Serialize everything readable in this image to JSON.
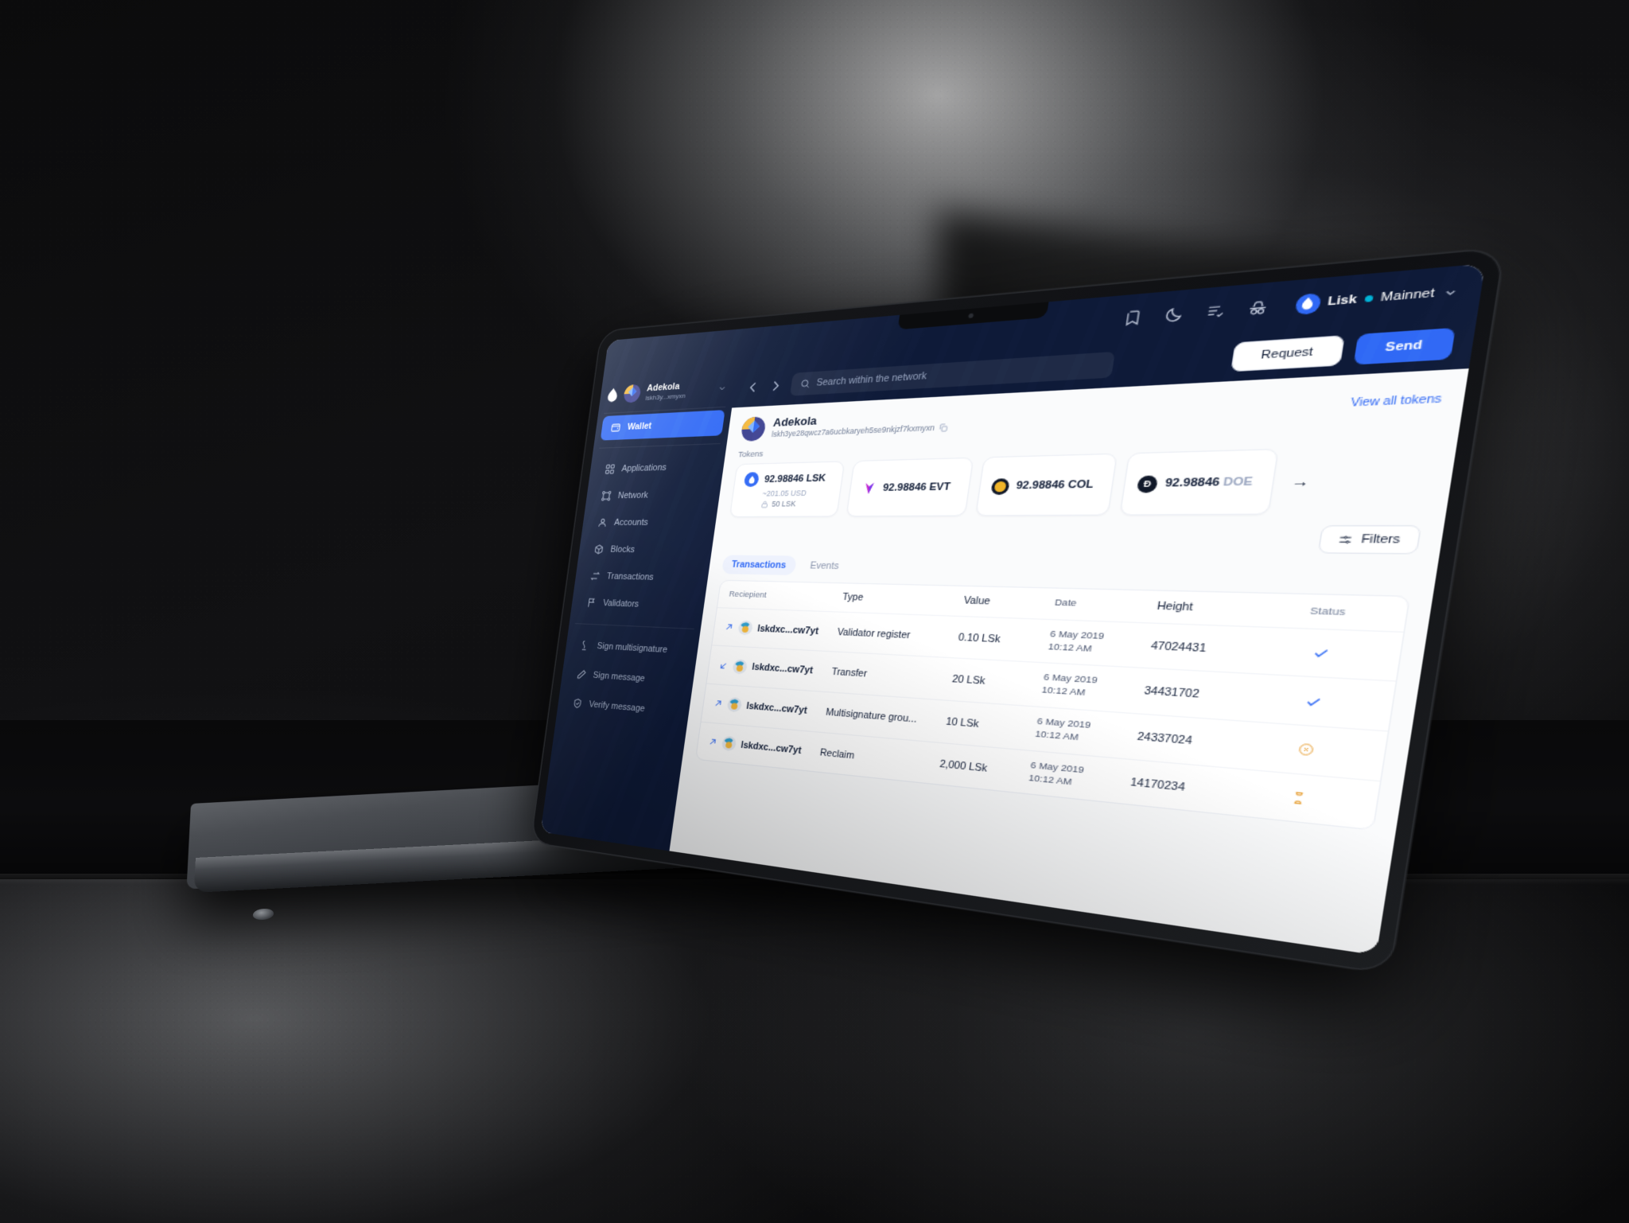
{
  "topbar": {
    "icons": [
      "bookmark-icon",
      "moon-icon",
      "list-check-icon",
      "incognito-icon"
    ],
    "network": {
      "chain": "Lisk",
      "environment": "Mainnet",
      "dot_color": "#00b4d8"
    }
  },
  "search": {
    "placeholder": "Search within the network"
  },
  "actions": {
    "request_label": "Request",
    "send_label": "Send"
  },
  "sidebar": {
    "account": {
      "name": "Adekola",
      "address_short": "lskh3y...xmyxn"
    },
    "items": [
      {
        "label": "Wallet",
        "icon": "wallet-icon",
        "active": true
      },
      {
        "label": "Applications",
        "icon": "applications-icon",
        "active": false
      },
      {
        "label": "Network",
        "icon": "network-icon",
        "active": false
      },
      {
        "label": "Accounts",
        "icon": "accounts-icon",
        "active": false
      },
      {
        "label": "Blocks",
        "icon": "blocks-icon",
        "active": false
      },
      {
        "label": "Transactions",
        "icon": "transactions-icon",
        "active": false
      },
      {
        "label": "Validators",
        "icon": "validators-icon",
        "active": false
      }
    ],
    "secondary_items": [
      {
        "label": "Sign multisignature",
        "icon": "signature-icon"
      },
      {
        "label": "Sign message",
        "icon": "pen-icon"
      },
      {
        "label": "Verify message",
        "icon": "shield-check-icon"
      }
    ]
  },
  "account_header": {
    "name": "Adekola",
    "address": "lskh3ye28qwcz7a6ucbkaryeh5se9nkjzf7kxmyxn",
    "view_all_tokens": "View all tokens"
  },
  "tokens": {
    "label": "Tokens",
    "items": [
      {
        "amount": "92.98846",
        "symbol": "LSK",
        "usd": "~201.05 USD",
        "locked": "50 LSK",
        "icon": "lsk-token-icon",
        "color": "#2f68f5",
        "dim": false
      },
      {
        "amount": "92.98846",
        "symbol": "EVT",
        "usd": "",
        "locked": "",
        "icon": "evt-token-icon",
        "color": "#d946ef",
        "dim": false
      },
      {
        "amount": "92.98846",
        "symbol": "COL",
        "usd": "",
        "locked": "",
        "icon": "col-token-icon",
        "color": "#f0b429",
        "dim": false
      },
      {
        "amount": "92.98846",
        "symbol": "DOE",
        "usd": "",
        "locked": "",
        "icon": "doe-token-icon",
        "color": "#101828",
        "dim": true
      }
    ]
  },
  "filters": {
    "label": "Filters"
  },
  "tabs": [
    {
      "label": "Transactions",
      "active": true
    },
    {
      "label": "Events",
      "active": false
    }
  ],
  "table": {
    "columns": [
      "Reciepient",
      "Type",
      "Value",
      "Date",
      "Height",
      "Status"
    ],
    "rows": [
      {
        "recipient": "lskdxc...cw7yt",
        "direction": "outgoing",
        "type": "Validator register",
        "value": "0.10 LSk",
        "date": "6 May 2019",
        "time": "10:12 AM",
        "height": "47024431",
        "status": "confirmed",
        "status_icon": "check-icon",
        "status_color": "#2f68f5"
      },
      {
        "recipient": "lskdxc...cw7yt",
        "direction": "incoming",
        "type": "Transfer",
        "value": "20 LSk",
        "date": "6 May 2019",
        "time": "10:12 AM",
        "height": "34431702",
        "status": "confirmed",
        "status_icon": "check-icon",
        "status_color": "#2f68f5"
      },
      {
        "recipient": "lskdxc...cw7yt",
        "direction": "outgoing",
        "type": "Multisignature grou...",
        "value": "10 LSk",
        "date": "6 May 2019",
        "time": "10:12 AM",
        "height": "24337024",
        "status": "failed",
        "status_icon": "circle-x-icon",
        "status_color": "#e8a33d"
      },
      {
        "recipient": "lskdxc...cw7yt",
        "direction": "outgoing",
        "type": "Reclaim",
        "value": "2,000 LSk",
        "date": "6 May 2019",
        "time": "10:12 AM",
        "height": "14170234",
        "status": "pending",
        "status_icon": "hourglass-icon",
        "status_color": "#e8a33d"
      }
    ]
  }
}
